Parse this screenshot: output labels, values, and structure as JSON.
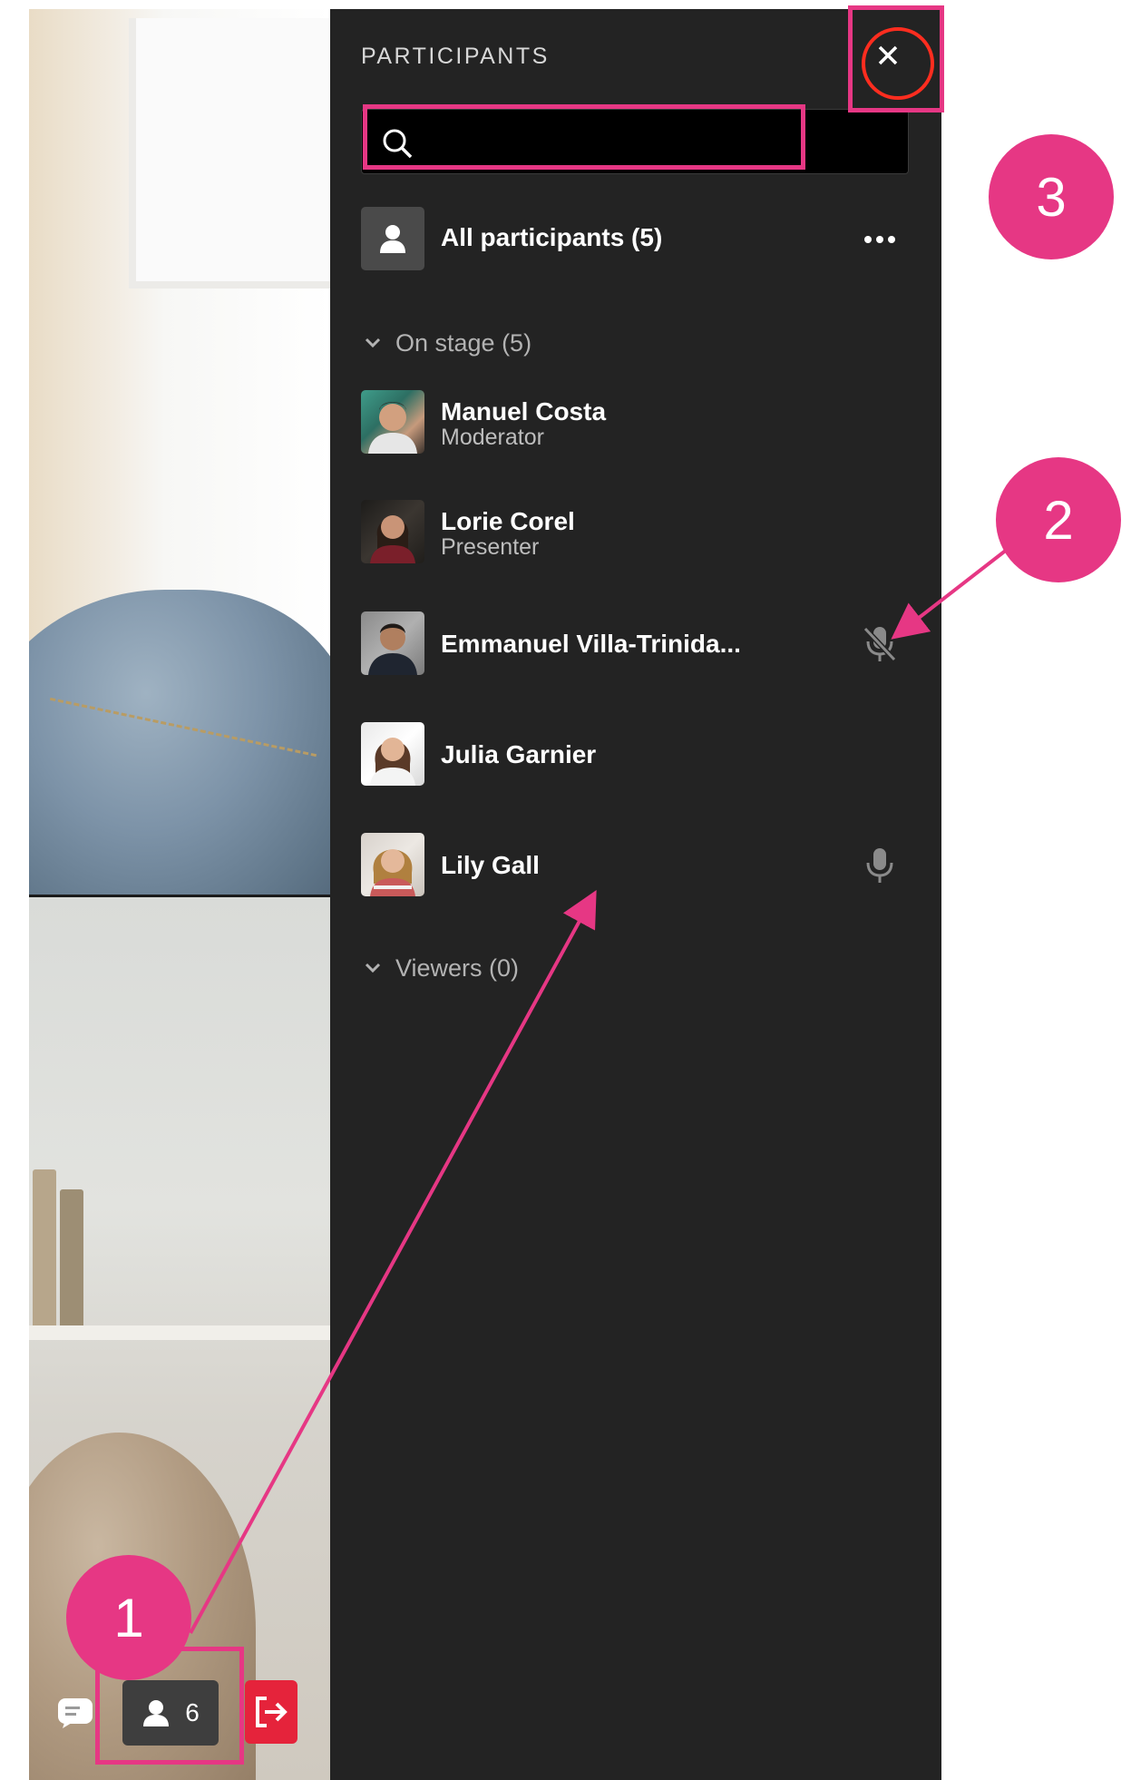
{
  "panel": {
    "title": "PARTICIPANTS",
    "search": {
      "value": "",
      "placeholder": ""
    },
    "all_participants_label": "All participants (5)",
    "sections": [
      {
        "label": "On stage (5)"
      },
      {
        "label": "Viewers (0)"
      }
    ],
    "participants": [
      {
        "name": "Manuel Costa",
        "role": "Moderator",
        "mic": "none"
      },
      {
        "name": "Lorie Corel",
        "role": "Presenter",
        "mic": "none"
      },
      {
        "name": "Emmanuel Villa-Trinida...",
        "role": "",
        "mic": "muted"
      },
      {
        "name": "Julia Garnier",
        "role": "",
        "mic": "none"
      },
      {
        "name": "Lily Gall",
        "role": "",
        "mic": "on"
      }
    ]
  },
  "toolbar": {
    "participants_count": "6"
  },
  "annotations": {
    "badge_1": "1",
    "badge_2": "2",
    "badge_3": "3",
    "color": "#e63784"
  },
  "colors": {
    "panel_bg": "#232323",
    "leave_button": "#e5233b"
  }
}
